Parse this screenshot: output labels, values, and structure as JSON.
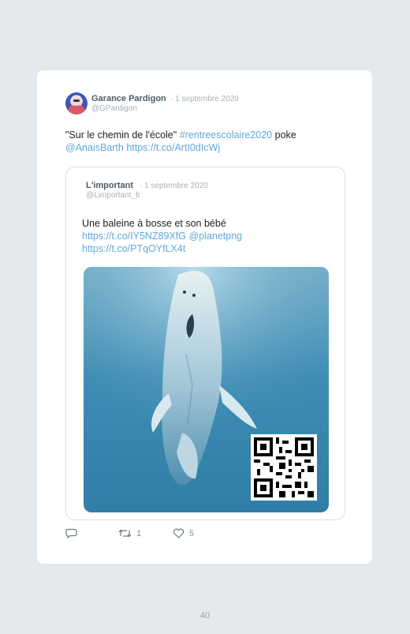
{
  "tweet": {
    "author_name": "Garance Pardigon",
    "date": "· 1 septembre 2020",
    "handle": "@GPardigon",
    "text_quote": "\"Sur le chemin de l'école\"",
    "hashtag": "#rentreescolaire2020",
    "text_poke": "poke",
    "mention": "@AnaisBarth",
    "link": "https://t.co/ArtI0dIcWj"
  },
  "quoted": {
    "author_name": "L'important",
    "date": "· 1 septembre 2020",
    "handle": "@Limportant_fr",
    "text": "Une baleine à bosse et son bébé",
    "link1": "https://t.co/IY5NZ89XfG",
    "mention": "@planetpng",
    "link2": "https://t.co/PTqOYfLX4t"
  },
  "actions": {
    "reply_icon": "reply-icon",
    "retweet_icon": "retweet-icon",
    "retweet_count": "1",
    "like_icon": "heart-icon",
    "like_count": "5"
  },
  "page_number": "40"
}
